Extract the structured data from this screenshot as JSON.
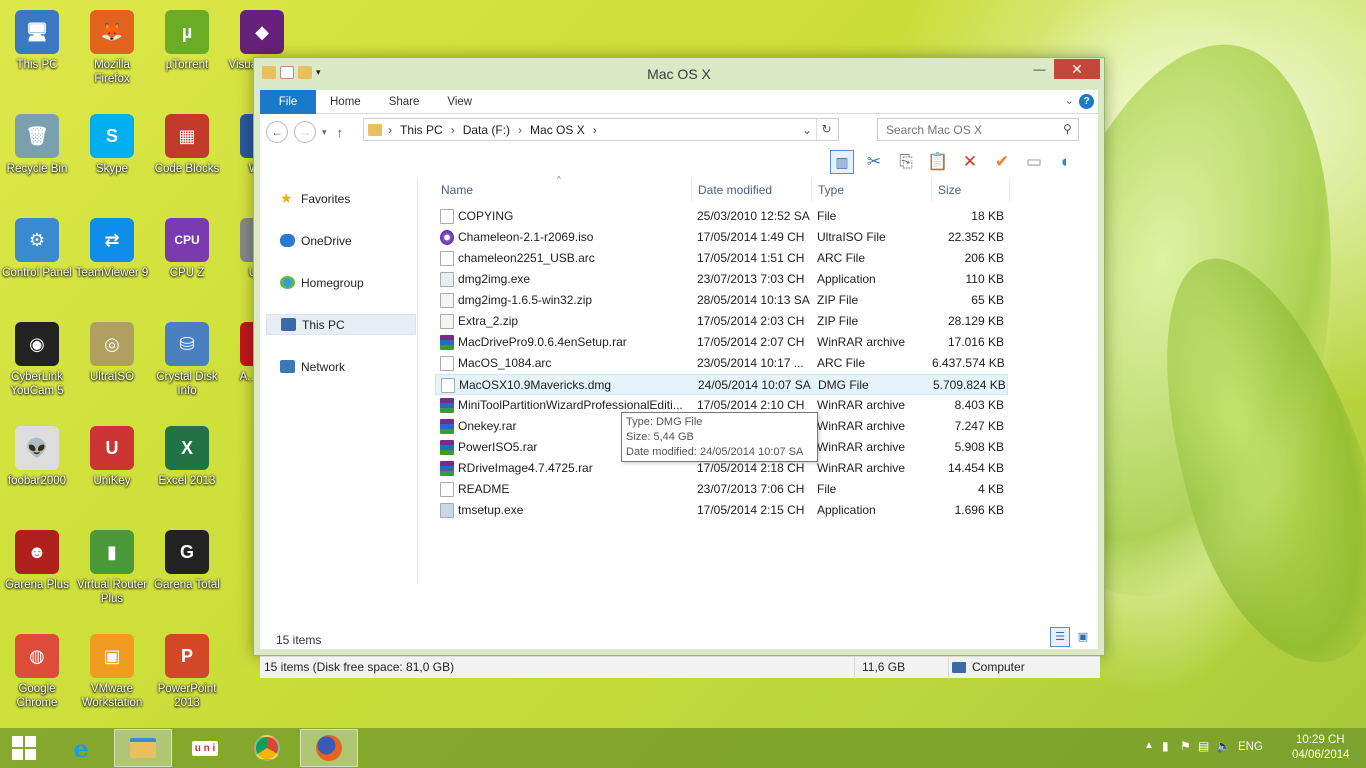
{
  "desktop": {
    "icons": [
      {
        "label": "This PC",
        "id": "this-pc",
        "glyph": "🖥",
        "color": "#3b78c4"
      },
      {
        "label": "Mozilla Firefox",
        "id": "firefox",
        "glyph": "🦊",
        "color": "#e2641c"
      },
      {
        "label": "µTorrent",
        "id": "utorrent",
        "glyph": "µ",
        "color": "#6aac24"
      },
      {
        "label": "Visual Studio",
        "id": "visual-studio",
        "glyph": "◆",
        "color": "#68217a"
      },
      {
        "label": "Recycle Bin",
        "id": "recycle-bin",
        "glyph": "🗑",
        "color": "#7aa0b0"
      },
      {
        "label": "Skype",
        "id": "skype",
        "glyph": "S",
        "color": "#00aff0"
      },
      {
        "label": "Code Blocks",
        "id": "code-blocks",
        "glyph": "▦",
        "color": "#c23a2a"
      },
      {
        "label": "Wo...",
        "id": "word",
        "glyph": "W",
        "color": "#2b579a"
      },
      {
        "label": "Control Panel",
        "id": "control-panel",
        "glyph": "⚙",
        "color": "#3a8ad0"
      },
      {
        "label": "TeamViewer 9",
        "id": "teamviewer",
        "glyph": "⇄",
        "color": "#0e8ee9"
      },
      {
        "label": "CPU Z",
        "id": "cpu-z",
        "glyph": "CPU",
        "color": "#7a3ab0"
      },
      {
        "label": "Uni...",
        "id": "unikey-2",
        "glyph": "U",
        "color": "#888"
      },
      {
        "label": "CyberLink YouCam 5",
        "id": "youcam",
        "glyph": "◉",
        "color": "#222"
      },
      {
        "label": "UltraISO",
        "id": "ultraiso",
        "glyph": "◎",
        "color": "#b0a060"
      },
      {
        "label": "Crystal Disk Info",
        "id": "crystaldisk",
        "glyph": "⛁",
        "color": "#4a80c0"
      },
      {
        "label": "A... Re...",
        "id": "acrobat",
        "glyph": "A",
        "color": "#c0181c"
      },
      {
        "label": "foobar2000",
        "id": "foobar",
        "glyph": "👽",
        "color": "#ddd"
      },
      {
        "label": "UniKey",
        "id": "unikey",
        "glyph": "U",
        "color": "#c33"
      },
      {
        "label": "Excel 2013",
        "id": "excel",
        "glyph": "X",
        "color": "#217346"
      },
      {
        "label": "Garena Plus",
        "id": "garena-plus",
        "glyph": "☻",
        "color": "#b0201c"
      },
      {
        "label": "Virtual Router Plus",
        "id": "virtual-router",
        "glyph": "▮",
        "color": "#4a9a3a"
      },
      {
        "label": "Garena Total",
        "id": "garena-total",
        "glyph": "G",
        "color": "#222"
      },
      {
        "label": "Google Chrome",
        "id": "chrome",
        "glyph": "◍",
        "color": "#dd4b39"
      },
      {
        "label": "VMware Workstation",
        "id": "vmware",
        "glyph": "▣",
        "color": "#f19a20"
      },
      {
        "label": "PowerPoint 2013",
        "id": "powerpoint",
        "glyph": "P",
        "color": "#d24726"
      }
    ]
  },
  "window": {
    "title": "Mac OS X",
    "controls": {
      "minimize": "—",
      "maximize": "☐",
      "close": "✕"
    },
    "ribbon_tabs": [
      "File",
      "Home",
      "Share",
      "View"
    ],
    "breadcrumb": [
      "This PC",
      "Data (F:)",
      "Mac OS X"
    ],
    "search_placeholder": "Search Mac OS X",
    "nav": [
      "Favorites",
      "OneDrive",
      "Homegroup",
      "This PC",
      "Network"
    ],
    "columns": [
      "Name",
      "Date modified",
      "Type",
      "Size"
    ],
    "files": [
      {
        "name": "COPYING",
        "date": "25/03/2010 12:52 SA",
        "type": "File",
        "size": "18 KB",
        "icon": "file"
      },
      {
        "name": "Chameleon-2.1-r2069.iso",
        "date": "17/05/2014 1:49 CH",
        "type": "UltraISO File",
        "size": "22.352 KB",
        "icon": "iso"
      },
      {
        "name": "chameleon2251_USB.arc",
        "date": "17/05/2014 1:51 CH",
        "type": "ARC File",
        "size": "206 KB",
        "icon": "file"
      },
      {
        "name": "dmg2img.exe",
        "date": "23/07/2013 7:03 CH",
        "type": "Application",
        "size": "110 KB",
        "icon": "exe"
      },
      {
        "name": "dmg2img-1.6.5-win32.zip",
        "date": "28/05/2014 10:13 SA",
        "type": "ZIP File",
        "size": "65 KB",
        "icon": "zip"
      },
      {
        "name": "Extra_2.zip",
        "date": "17/05/2014 2:03 CH",
        "type": "ZIP File",
        "size": "28.129 KB",
        "icon": "zip"
      },
      {
        "name": "MacDrivePro9.0.6.4enSetup.rar",
        "date": "17/05/2014 2:07 CH",
        "type": "WinRAR archive",
        "size": "17.016 KB",
        "icon": "rar"
      },
      {
        "name": "MacOS_1084.arc",
        "date": "23/05/2014 10:17 ...",
        "type": "ARC File",
        "size": "6.437.574 KB",
        "icon": "file"
      },
      {
        "name": "MacOSX10.9Mavericks.dmg",
        "date": "24/05/2014 10:07 SA",
        "type": "DMG File",
        "size": "5.709.824 KB",
        "icon": "file"
      },
      {
        "name": "MiniToolPartitionWizardProfessionalEditi...",
        "date": "17/05/2014 2:10 CH",
        "type": "WinRAR archive",
        "size": "8.403 KB",
        "icon": "rar"
      },
      {
        "name": "Onekey.rar",
        "date": "17/05/2014 2:10 CH",
        "type": "WinRAR archive",
        "size": "7.247 KB",
        "icon": "rar"
      },
      {
        "name": "PowerISO5.rar",
        "date": "17/05/2014 2:10 CH",
        "type": "WinRAR archive",
        "size": "5.908 KB",
        "icon": "rar"
      },
      {
        "name": "RDriveImage4.7.4725.rar",
        "date": "17/05/2014 2:18 CH",
        "type": "WinRAR archive",
        "size": "14.454 KB",
        "icon": "rar"
      },
      {
        "name": "README",
        "date": "23/07/2013 7:06 CH",
        "type": "File",
        "size": "4 KB",
        "icon": "file"
      },
      {
        "name": "tmsetup.exe",
        "date": "17/05/2014 2:15 CH",
        "type": "Application",
        "size": "1.696 KB",
        "icon": "setup"
      }
    ],
    "selected_index": 8,
    "tooltip": [
      "Type: DMG File",
      "Size: 5,44 GB",
      "Date modified: 24/05/2014 10:07 SA"
    ],
    "item_count": "15 items",
    "status_left": "15 items (Disk free space: 81,0 GB)",
    "status_size": "11,6 GB",
    "status_location": "Computer"
  },
  "taskbar": {
    "lang": "ENG",
    "time": "10:29 CH",
    "date": "04/06/2014"
  },
  "colors": {
    "accent": "#1979ca",
    "selection": "#e5f3fb",
    "close": "#c7463c"
  }
}
